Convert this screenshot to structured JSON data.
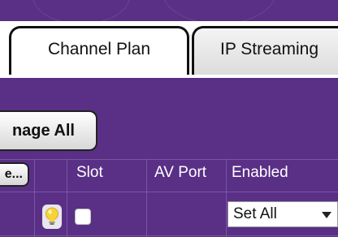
{
  "tabs": [
    {
      "label": "Channel Plan",
      "active": true
    },
    {
      "label": "IP Streaming",
      "active": false
    }
  ],
  "toolbar": {
    "manage_all_label": "nage All"
  },
  "table": {
    "more_button_label": "e...",
    "columns": [
      "Slot",
      "AV Port",
      "Enabled"
    ],
    "row": {
      "icon": "lightbulb-icon",
      "enabled_select_value": "Set All"
    }
  },
  "colors": {
    "panel_purple": "#5a2f86",
    "tab_border": "#111111",
    "bulb_yellow": "#f6d33a"
  }
}
